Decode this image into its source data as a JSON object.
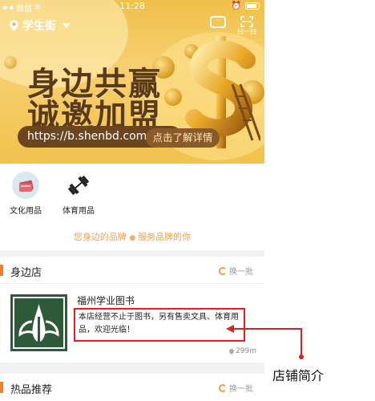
{
  "status_bar": {
    "carrier": "微信",
    "time": "11:28"
  },
  "header": {
    "location": "学生街",
    "scan_label": "扫一扫"
  },
  "banner": {
    "line1": "身边共赢",
    "line2": "诚邀加盟",
    "url": "https://b.shenbd.com",
    "cta": "点击了解详情"
  },
  "categories": [
    {
      "label": "文化用品",
      "icon": "books-icon"
    },
    {
      "label": "体育用品",
      "icon": "dumbbell-icon"
    }
  ],
  "brand_line": {
    "left": "您身边的品牌",
    "right": "服务品牌的你"
  },
  "nearby": {
    "title": "身边店",
    "refresh": "换一批",
    "store": {
      "name": "福州学业图书",
      "description": "本店经营不止于图书，另有售卖文具、体育用品，欢迎光临！",
      "distance": "299m"
    }
  },
  "hot": {
    "title": "热品推荐",
    "refresh": "换一批"
  },
  "annotation": {
    "caption": "店铺简介",
    "color": "#e02020"
  },
  "colors": {
    "accent": "#f08030",
    "banner_text": "#5a3a18"
  }
}
